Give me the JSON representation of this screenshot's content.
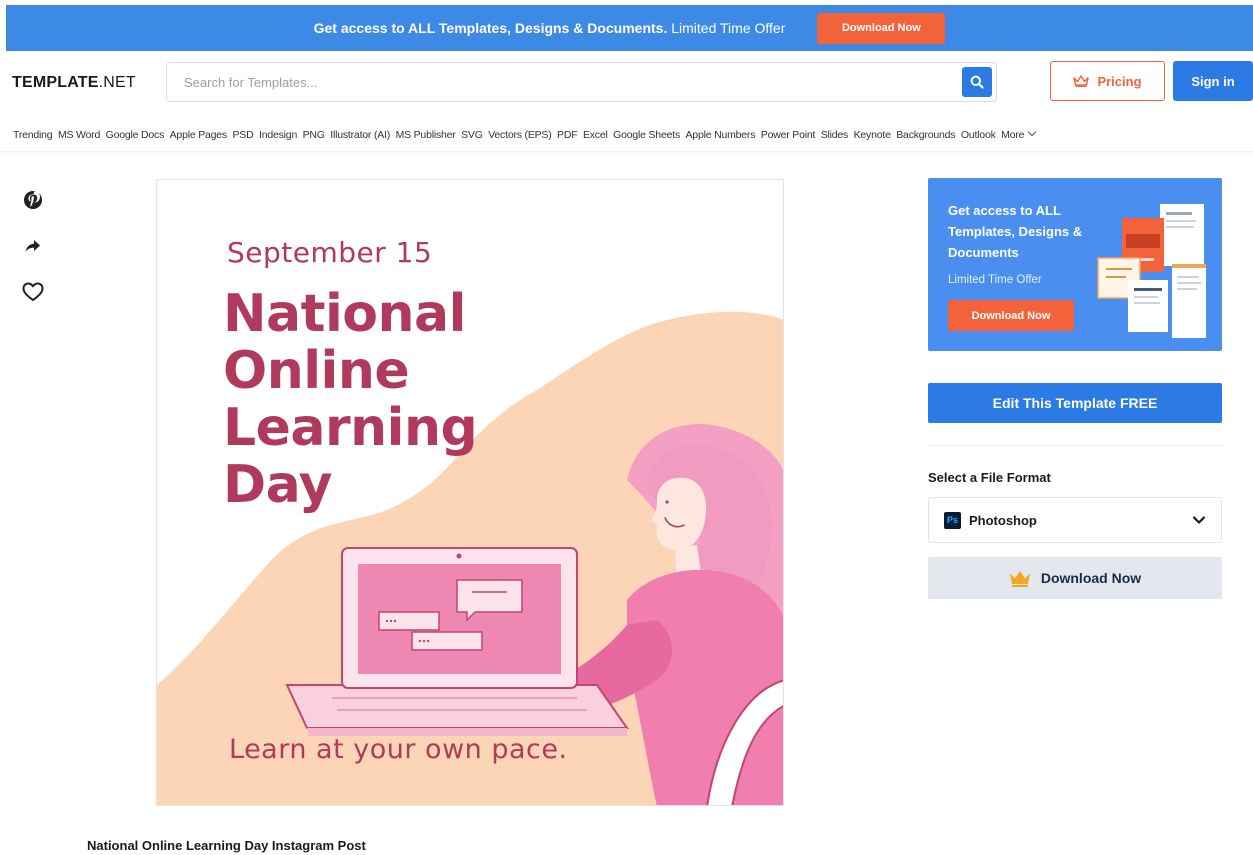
{
  "promo": {
    "text_bold": "Get access to ALL Templates, Designs & Documents.",
    "text_regular": "Limited Time Offer",
    "button_label": "Download Now"
  },
  "header": {
    "logo_bold": "TEMPLATE",
    "logo_regular": ".NET",
    "search_placeholder": "Search for Templates...",
    "search_icon": "search-icon",
    "pricing_label": "Pricing",
    "pricing_icon": "crown-icon",
    "signin_label": "Sign in"
  },
  "categories": [
    "Trending",
    "MS Word",
    "Google Docs",
    "Apple Pages",
    "PSD",
    "Indesign",
    "PNG",
    "Illustrator (AI)",
    "MS Publisher",
    "SVG",
    "Vectors (EPS)",
    "PDF",
    "Excel",
    "Google Sheets",
    "Apple Numbers",
    "Power Point",
    "Slides",
    "Keynote",
    "Backgrounds",
    "Outlook",
    "More"
  ],
  "social_icons": [
    "pinterest-icon",
    "share-icon",
    "heart-icon"
  ],
  "preview": {
    "date": "September 15",
    "title_lines": [
      "National",
      "Online",
      "Learning",
      "Day"
    ],
    "tagline": "Learn at your own pace.",
    "caption": "National Online Learning Day Instagram Post"
  },
  "sidebar": {
    "ad_title": "Get access to ALL Templates, Designs & Documents",
    "ad_offer": "Limited Time Offer",
    "ad_button": "Download Now",
    "edit_button": "Edit This Template FREE",
    "format_label": "Select a File Format",
    "format_icon_text": "Ps",
    "format_value": "Photoshop",
    "download_button": "Download Now"
  },
  "colors": {
    "brand_blue": "#2c7be5",
    "promo_blue": "#3d8ae6",
    "accent_orange": "#f2623b",
    "poster_text": "#b03a5b",
    "poster_peach": "#fbd5b5",
    "poster_pink": "#f07fb0"
  }
}
